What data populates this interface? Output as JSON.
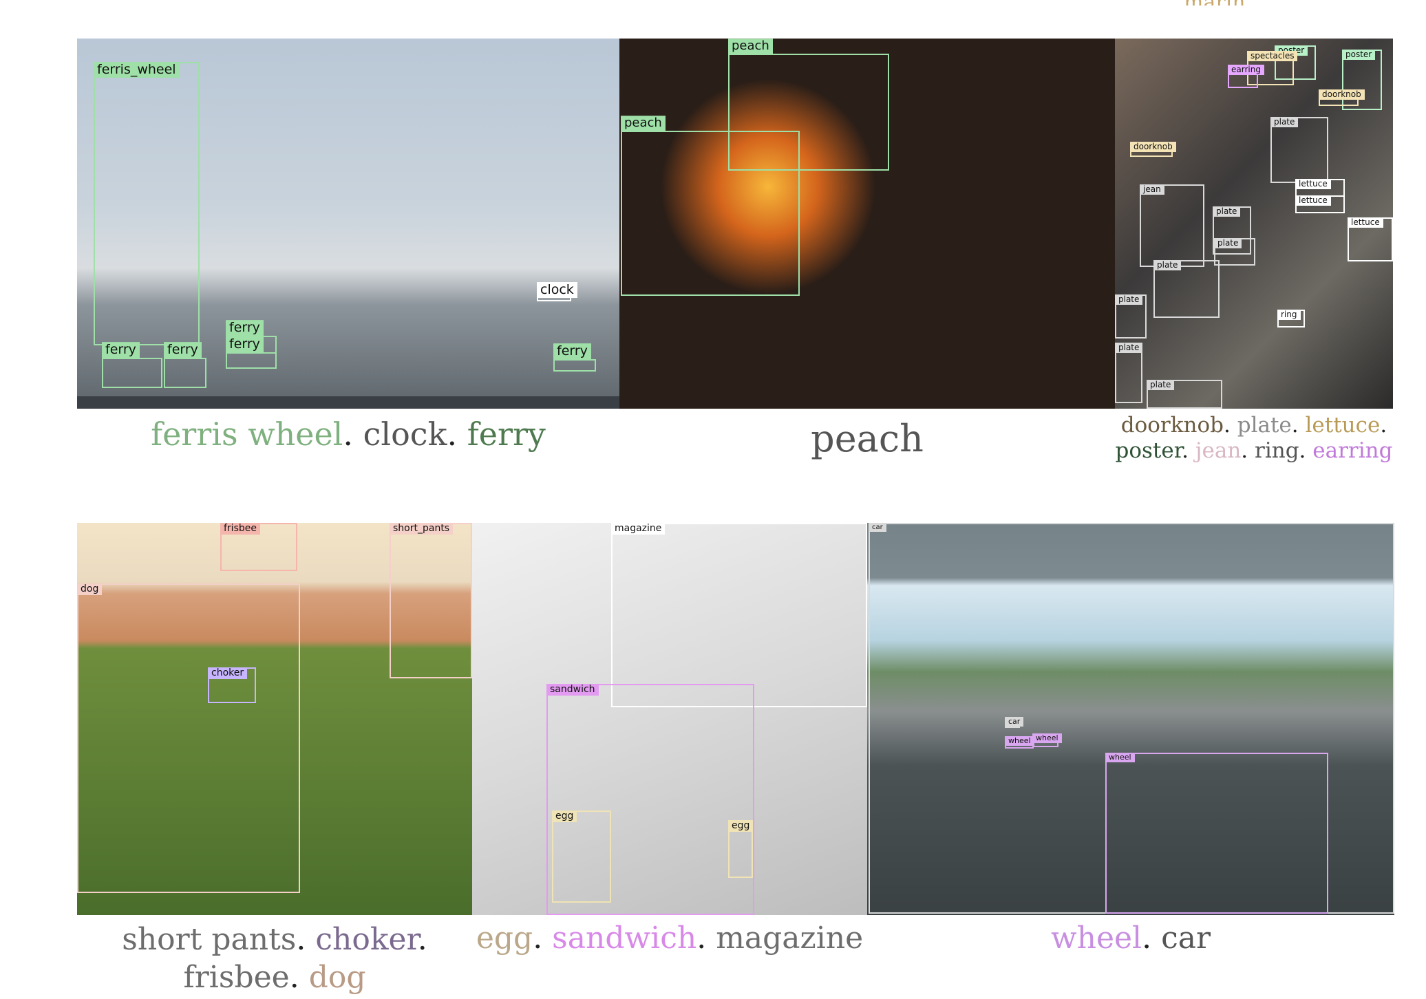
{
  "top_fragment": "marin",
  "panels": [
    {
      "id": "london",
      "boxes": [
        {
          "label": "ferris_wheel",
          "color": "#9fe0a8"
        },
        {
          "label": "clock",
          "color": "#ffffff"
        },
        {
          "label": "ferry",
          "color": "#9fe0a8"
        },
        {
          "label": "ferry",
          "color": "#9fe0a8"
        },
        {
          "label": "ferry",
          "color": "#9fe0a8"
        },
        {
          "label": "ferry",
          "color": "#9fe0a8"
        },
        {
          "label": "ferry",
          "color": "#9fe0a8"
        }
      ],
      "caption": [
        {
          "text": "ferris wheel",
          "color": "#7fb07f"
        },
        {
          "text": ". "
        },
        {
          "text": "clock",
          "color": "#555555"
        },
        {
          "text": ". "
        },
        {
          "text": "ferry",
          "color": "#4f7a4f"
        }
      ]
    },
    {
      "id": "food",
      "boxes": [
        {
          "label": "peach",
          "color": "#9fe0a8"
        },
        {
          "label": "peach",
          "color": "#9fe0a8"
        }
      ],
      "caption": [
        {
          "text": "peach",
          "color": "#555555"
        }
      ]
    },
    {
      "id": "kitchen",
      "boxes": [
        {
          "label": "poster",
          "color": "#b8f0c8"
        },
        {
          "label": "spectacles",
          "color": "#f3e3b5"
        },
        {
          "label": "poster",
          "color": "#b8f0c8"
        },
        {
          "label": "earring",
          "color": "#e6a8ff"
        },
        {
          "label": "doorknob",
          "color": "#f3e3b5"
        },
        {
          "label": "plate",
          "color": "#d9d9d9"
        },
        {
          "label": "doorknob",
          "color": "#f3e3b5"
        },
        {
          "label": "lettuce",
          "color": "#ffffff"
        },
        {
          "label": "lettuce",
          "color": "#ffffff"
        },
        {
          "label": "jean",
          "color": "#d9d9d9"
        },
        {
          "label": "plate",
          "color": "#d9d9d9"
        },
        {
          "label": "lettuce",
          "color": "#ffffff"
        },
        {
          "label": "plate",
          "color": "#d9d9d9"
        },
        {
          "label": "plate",
          "color": "#d9d9d9"
        },
        {
          "label": "plate",
          "color": "#d9d9d9"
        },
        {
          "label": "ring",
          "color": "#ffffff"
        },
        {
          "label": "plate",
          "color": "#d9d9d9"
        },
        {
          "label": "plate",
          "color": "#d9d9d9"
        }
      ],
      "caption_line1": [
        {
          "text": "doorknob",
          "color": "#6b5a3f"
        },
        {
          "text": ". "
        },
        {
          "text": "plate",
          "color": "#8a8a8a"
        },
        {
          "text": ". "
        },
        {
          "text": "lettuce",
          "color": "#b89a55"
        },
        {
          "text": "."
        }
      ],
      "caption_line2": [
        {
          "text": "poster",
          "color": "#2f5236"
        },
        {
          "text": ". "
        },
        {
          "text": "jean",
          "color": "#d9b7c4"
        },
        {
          "text": ". "
        },
        {
          "text": "ring",
          "color": "#555555"
        },
        {
          "text": ". "
        },
        {
          "text": "earring",
          "color": "#c17ad9"
        }
      ]
    },
    {
      "id": "park",
      "boxes": [
        {
          "label": "frisbee",
          "color": "#f4b5ad"
        },
        {
          "label": "short_pants",
          "color": "#f4d0c8"
        },
        {
          "label": "dog",
          "color": "#f4d0c8"
        },
        {
          "label": "choker",
          "color": "#c8b5ff"
        }
      ],
      "caption_line1": [
        {
          "text": "short pants",
          "color": "#6d6d6d"
        },
        {
          "text": ". "
        },
        {
          "text": "choker",
          "color": "#7b6a8f"
        },
        {
          "text": "."
        }
      ],
      "caption_line2": [
        {
          "text": "frisbee",
          "color": "#6d6d6d"
        },
        {
          "text": ". "
        },
        {
          "text": "dog",
          "color": "#b89a85"
        }
      ]
    },
    {
      "id": "table",
      "boxes": [
        {
          "label": "magazine",
          "color": "#ffffff"
        },
        {
          "label": "sandwich",
          "color": "#e29bf0"
        },
        {
          "label": "egg",
          "color": "#f0e3b5"
        },
        {
          "label": "egg",
          "color": "#f0e3b5"
        }
      ],
      "caption": [
        {
          "text": "egg",
          "color": "#bba88a"
        },
        {
          "text": ". "
        },
        {
          "text": "sandwich",
          "color": "#d889e8"
        },
        {
          "text": ". "
        },
        {
          "text": "magazine",
          "color": "#6d6d6d"
        }
      ]
    },
    {
      "id": "car",
      "boxes": [
        {
          "label": "car",
          "color": "#d9d9d9"
        },
        {
          "label": "wheel",
          "color": "#d9a6f0"
        },
        {
          "label": "wheel",
          "color": "#d9a6f0"
        },
        {
          "label": "car",
          "color": "#d9d9d9"
        },
        {
          "label": "wheel",
          "color": "#d9a6f0"
        }
      ],
      "caption": [
        {
          "text": "wheel",
          "color": "#c88ee0"
        },
        {
          "text": ". "
        },
        {
          "text": "car",
          "color": "#555555"
        }
      ]
    }
  ]
}
